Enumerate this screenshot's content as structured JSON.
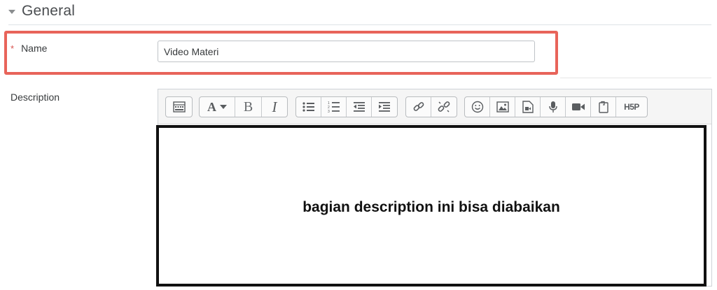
{
  "section": {
    "title": "General"
  },
  "name_field": {
    "label": "Name",
    "required_marker": "*",
    "value": "Video Materi"
  },
  "description_field": {
    "label": "Description"
  },
  "editor": {
    "toolbar_icons": [
      [
        "toolbar-toggle-icon"
      ],
      [
        "font-style-icon",
        "bold-icon",
        "italic-icon"
      ],
      [
        "unordered-list-icon",
        "ordered-list-icon",
        "outdent-icon",
        "indent-icon"
      ],
      [
        "link-icon",
        "unlink-icon"
      ],
      [
        "emoji-icon",
        "image-icon",
        "media-icon",
        "record-audio-icon",
        "record-video-icon",
        "manage-files-icon",
        "h5p-icon"
      ]
    ],
    "labels": {
      "font": "A",
      "bold": "B",
      "italic": "I",
      "h5p": "H5P"
    },
    "content": "bagian description ini bisa diabaikan"
  },
  "colors": {
    "highlight": "#e8645a",
    "required": "#d9534f",
    "content_border": "#111111"
  }
}
